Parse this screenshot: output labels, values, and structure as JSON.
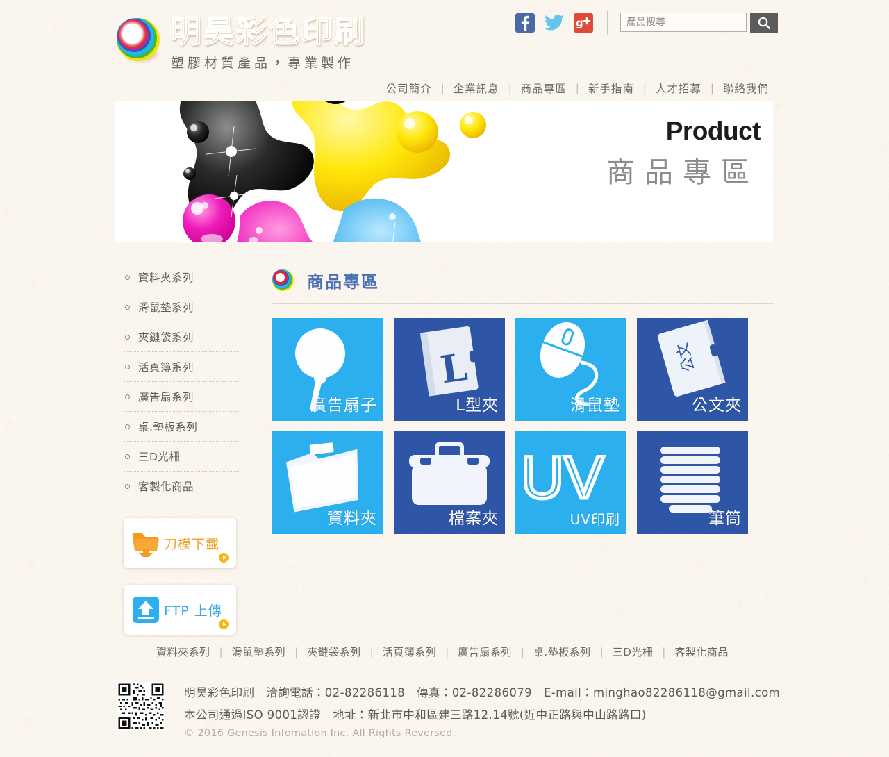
{
  "site": {
    "brand_title": "明昊彩色印刷",
    "brand_subtitle": "塑膠材質產品，專業製作",
    "logo_icon": "rainbow-circle-logo"
  },
  "header": {
    "social": [
      {
        "name": "facebook-icon",
        "label": "f",
        "color": "#4a69a5"
      },
      {
        "name": "twitter-icon",
        "label": "t",
        "color": "#63c5ea"
      },
      {
        "name": "google-plus-icon",
        "label": "g+",
        "color": "#dd4b39"
      }
    ],
    "search": {
      "placeholder": "產品搜尋",
      "value": "",
      "button_icon": "search-icon"
    }
  },
  "nav": {
    "items": [
      {
        "label": "公司簡介"
      },
      {
        "label": "企業訊息"
      },
      {
        "label": "商品專區"
      },
      {
        "label": "新手指南"
      },
      {
        "label": "人才招募"
      },
      {
        "label": "聯絡我們"
      }
    ],
    "separator": "|"
  },
  "banner": {
    "title_en": "Product",
    "title_zh": "商品專區",
    "art": "cmyk-ink-blobs-bubbles"
  },
  "sidebar": {
    "categories": [
      {
        "label": "資料夾系列"
      },
      {
        "label": "滑鼠墊系列"
      },
      {
        "label": "夾鏈袋系列"
      },
      {
        "label": "活頁簿系列"
      },
      {
        "label": "廣告扇系列"
      },
      {
        "label": "桌.墊板系列"
      },
      {
        "label": "三D光柵"
      },
      {
        "label": "客製化商品"
      }
    ],
    "buttons": [
      {
        "label": "刀模下載",
        "icon": "folder-download-icon",
        "color": "#f2a127"
      },
      {
        "label": "FTP 上傳",
        "icon": "ftp-upload-icon",
        "color": "#3aa9e8"
      }
    ]
  },
  "main": {
    "section_title": "商品專區",
    "section_icon": "rainbow-circle-logo",
    "products": [
      {
        "label": "廣告扇子",
        "icon": "hand-fan-icon",
        "tone": "light"
      },
      {
        "label": "L型夾",
        "icon": "l-folder-icon",
        "tone": "dark"
      },
      {
        "label": "滑鼠墊",
        "icon": "mouse-icon",
        "tone": "light"
      },
      {
        "label": "公文夾",
        "icon": "document-folder-icon",
        "tone": "dark"
      },
      {
        "label": "資料夾",
        "icon": "file-folder-icon",
        "tone": "light"
      },
      {
        "label": "檔案夾",
        "icon": "briefcase-icon",
        "tone": "dark"
      },
      {
        "label": "UV印刷",
        "icon": "uv-text-icon",
        "tone": "light",
        "big_text": "UV"
      },
      {
        "label": "筆筒",
        "icon": "pen-holder-icon",
        "tone": "dark"
      }
    ]
  },
  "footer": {
    "nav": [
      {
        "label": "資料夾系列"
      },
      {
        "label": "滑鼠墊系列"
      },
      {
        "label": "夾鏈袋系列"
      },
      {
        "label": "活頁簿系列"
      },
      {
        "label": "廣告扇系列"
      },
      {
        "label": "桌.墊板系列"
      },
      {
        "label": "三D光柵"
      },
      {
        "label": "客製化商品"
      }
    ],
    "separator": "|",
    "qr_icon": "qr-code",
    "info_line1": "明昊彩色印刷　洽詢電話：02-82286118　傳真：02-82286079　E-mail：minghao82286118@gmail.com",
    "info_line2": "本公司通過ISO 9001認證　地址：新北市中和區建三路12.14號(近中正路與中山路路口)",
    "copyright": "© 2016 Genesis Infomation Inc. All Rights Reversed."
  },
  "colors": {
    "page_bg": "#fbf7f1",
    "tile_light": "#2cafee",
    "tile_dark": "#2f56a6",
    "accent_blue": "#4a6fb5",
    "accent_orange": "#f2a127"
  }
}
